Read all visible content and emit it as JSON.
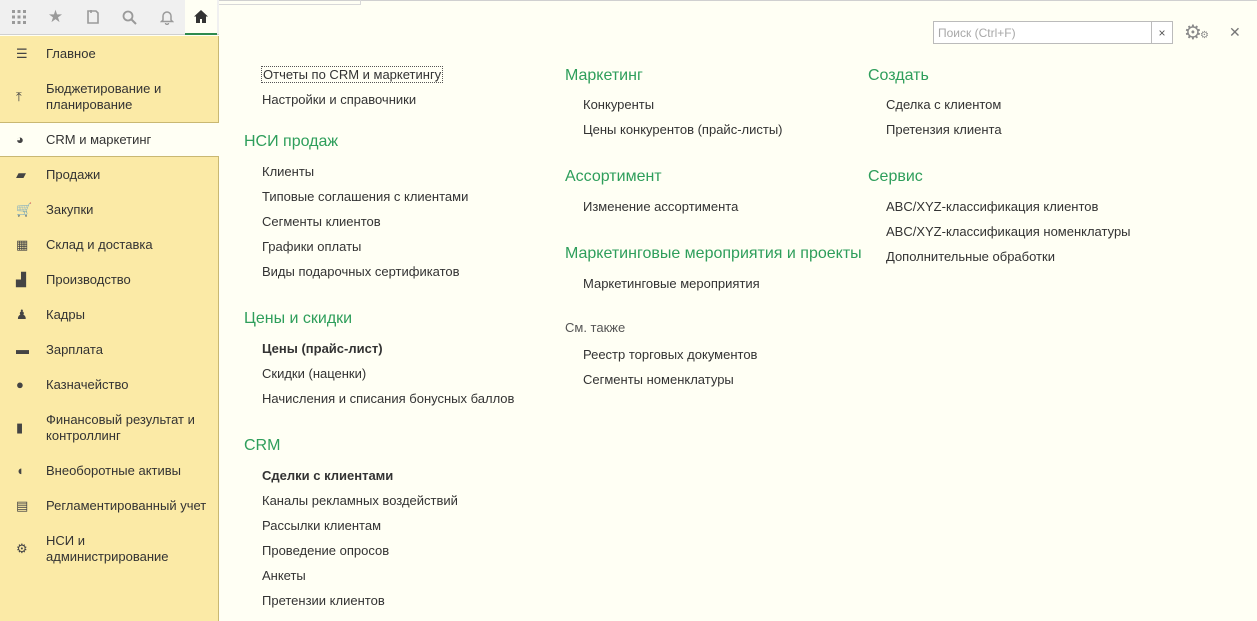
{
  "search": {
    "placeholder": "Поиск (Ctrl+F)",
    "clear": "×"
  },
  "sidebar": {
    "items": [
      {
        "label": "Главное",
        "icon": "☰"
      },
      {
        "label": "Бюджетирование и планирование",
        "icon": "⤒"
      },
      {
        "label": "CRM и маркетинг",
        "icon": "◕"
      },
      {
        "label": "Продажи",
        "icon": "▰"
      },
      {
        "label": "Закупки",
        "icon": "🛒"
      },
      {
        "label": "Склад и доставка",
        "icon": "▦"
      },
      {
        "label": "Производство",
        "icon": "▟"
      },
      {
        "label": "Кадры",
        "icon": "♟"
      },
      {
        "label": "Зарплата",
        "icon": "▬"
      },
      {
        "label": "Казначейство",
        "icon": "●"
      },
      {
        "label": "Финансовый результат и контроллинг",
        "icon": "▮"
      },
      {
        "label": "Внеоборотные активы",
        "icon": "◖"
      },
      {
        "label": "Регламентированный учет",
        "icon": "▤"
      },
      {
        "label": "НСИ и администрирование",
        "icon": "⚙"
      }
    ]
  },
  "col1": {
    "top_links": [
      "Отчеты по CRM и маркетингу",
      "Настройки и справочники"
    ],
    "nsi_heading": "НСИ продаж",
    "nsi_links": [
      "Клиенты",
      "Типовые соглашения с клиентами",
      "Сегменты клиентов",
      "Графики оплаты",
      "Виды подарочных сертификатов"
    ],
    "prices_heading": "Цены и скидки",
    "prices_links": [
      "Цены (прайс-лист)",
      "Скидки (наценки)",
      "Начисления и списания бонусных баллов"
    ],
    "crm_heading": "CRM",
    "crm_links": [
      "Сделки с клиентами",
      "Каналы рекламных воздействий",
      "Рассылки клиентам",
      "Проведение опросов",
      "Анкеты",
      "Претензии клиентов"
    ]
  },
  "col2": {
    "marketing_heading": "Маркетинг",
    "marketing_links": [
      "Конкуренты",
      "Цены конкурентов (прайс-листы)"
    ],
    "assortment_heading": "Ассортимент",
    "assortment_links": [
      "Изменение ассортимента"
    ],
    "events_heading": "Маркетинговые мероприятия и проекты",
    "events_links": [
      "Маркетинговые мероприятия"
    ],
    "see_also": "См. также",
    "see_also_links": [
      "Реестр торговых документов",
      "Сегменты номенклатуры"
    ]
  },
  "col3": {
    "create_heading": "Создать",
    "create_links": [
      "Сделка с клиентом",
      "Претензия клиента"
    ],
    "service_heading": "Сервис",
    "service_links": [
      "ABC/XYZ-классификация клиентов",
      "ABC/XYZ-классификация номенклатуры",
      "Дополнительные обработки"
    ]
  }
}
